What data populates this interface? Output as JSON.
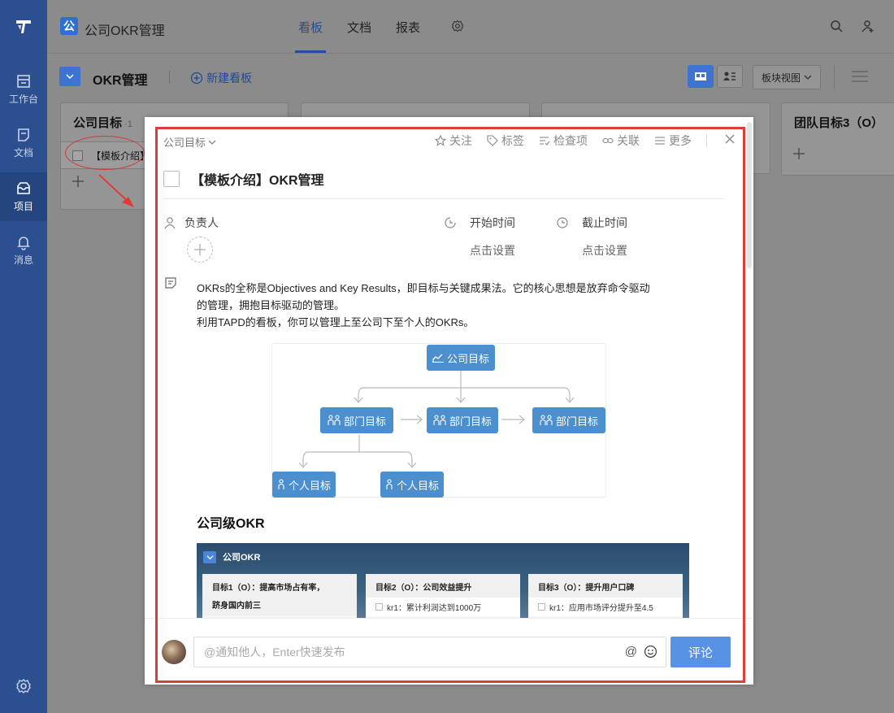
{
  "sidebar": {
    "items": [
      {
        "label": "工作台"
      },
      {
        "label": "文档"
      },
      {
        "label": "项目"
      },
      {
        "label": "消息"
      }
    ]
  },
  "header": {
    "app_icon": "公",
    "app_title": "公司OKR管理",
    "tabs": [
      {
        "label": "看板",
        "active": true
      },
      {
        "label": "文档"
      },
      {
        "label": "报表"
      }
    ]
  },
  "board_header": {
    "title": "OKR管理",
    "new_board": "新建看板",
    "view_select": "板块视图"
  },
  "columns": [
    {
      "title": "公司目标",
      "count": "1",
      "card": "【模板介绍】OKR管理"
    },
    {
      "title": "团队目标3（O）"
    }
  ],
  "modal": {
    "breadcrumb": "公司目标",
    "actions": [
      "关注",
      "标签",
      "检查项",
      "关联",
      "更多"
    ],
    "title": "【模板介绍】OKR管理",
    "owner_label": "负责人",
    "start_label": "开始时间",
    "end_label": "截止时间",
    "start_value": "点击设置",
    "end_value": "点击设置",
    "desc_line1": "OKRs的全称是Objectives and Key Results，即目标与关键成果法。它的核心思想是放弃命令驱动",
    "desc_line2": "的管理，拥抱目标驱动的管理。",
    "desc_line3": "利用TAPD的看板，你可以管理上至公司下至个人的OKRs。",
    "diagram": {
      "top": "公司目标",
      "mid": [
        "部门目标",
        "部门目标",
        "部门目标"
      ],
      "bottom": [
        "个人目标",
        "个人目标"
      ]
    },
    "section_title": "公司级OKR",
    "embed": {
      "header": "公司OKR",
      "cards": [
        {
          "title": "目标1（O）：提高市场占有率，",
          "title2": "跻身国内前三"
        },
        {
          "title": "目标2（O）：公司效益提升",
          "kr": "kr1：累计利润达到1000万"
        },
        {
          "title": "目标3（O）：提升用户口碑",
          "kr": "kr1：应用市场评分提升至4.5"
        }
      ]
    },
    "comment_placeholder": "@通知他人，Enter快速发布",
    "comment_button": "评论"
  },
  "colors": {
    "sidebar": "#2b4f8f",
    "accent": "#3e73cf",
    "node": "#4c8fce",
    "annotation": "#e03b3b"
  }
}
